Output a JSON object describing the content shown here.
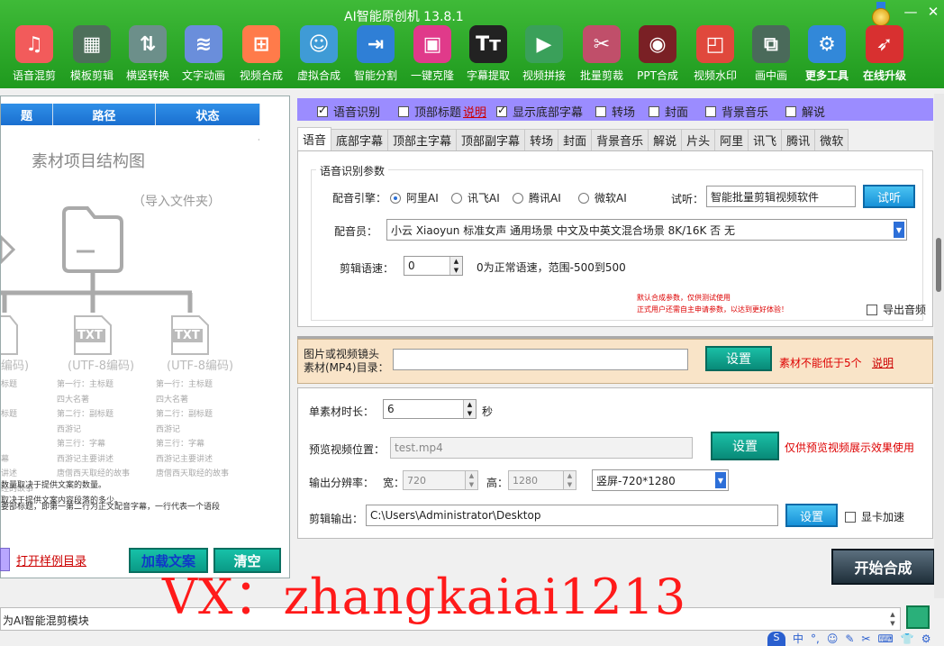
{
  "app": {
    "title": "AI智能原创机 13.8.1",
    "minimize": "—",
    "close": "✕"
  },
  "toolbar": [
    {
      "label": "语音混剪",
      "icon": "music-note-icon",
      "glyph": "♫",
      "color": "#f25b5b"
    },
    {
      "label": "模板剪辑",
      "icon": "template-icon",
      "glyph": "▦",
      "color": "#4d6f5a"
    },
    {
      "label": "横竖转换",
      "icon": "rotate-icon",
      "glyph": "⇅",
      "color": "#6c8f8a"
    },
    {
      "label": "文字动画",
      "icon": "waveform-icon",
      "glyph": "≋",
      "color": "#6a8edb"
    },
    {
      "label": "视频合成",
      "icon": "grid-icon",
      "glyph": "⊞",
      "color": "#ff7b4a"
    },
    {
      "label": "虚拟合成",
      "icon": "avatar-icon",
      "glyph": "☺",
      "color": "#3f9bd6"
    },
    {
      "label": "智能分割",
      "icon": "split-icon",
      "glyph": "⇥",
      "color": "#2f7fd6"
    },
    {
      "label": "一键克隆",
      "icon": "clone-icon",
      "glyph": "▣",
      "color": "#e03a8a"
    },
    {
      "label": "字幕提取",
      "icon": "text-tt-icon",
      "glyph": "Tт",
      "color": "#222222"
    },
    {
      "label": "视频拼接",
      "icon": "video-join-icon",
      "glyph": "▶",
      "color": "#3aa05a"
    },
    {
      "label": "批量剪裁",
      "icon": "crop-icon",
      "glyph": "✂",
      "color": "#c04f6a"
    },
    {
      "label": "PPT合成",
      "icon": "ppt-icon",
      "glyph": "◉",
      "color": "#7a2025"
    },
    {
      "label": "视频水印",
      "icon": "watermark-icon",
      "glyph": "◰",
      "color": "#e0483c"
    },
    {
      "label": "画中画",
      "icon": "pip-icon",
      "glyph": "⧉",
      "color": "#4a6a5a"
    },
    {
      "label": "更多工具",
      "icon": "more-tools-icon",
      "glyph": "⚙",
      "color": "#3288d9"
    },
    {
      "label": "在线升级",
      "icon": "rocket-icon",
      "glyph": "➶",
      "color": "#d83030"
    }
  ],
  "left": {
    "headers": [
      "题",
      "路径",
      "状态"
    ],
    "diagram_title": "素材项目结构图",
    "import_hint": "（导入文件夹）",
    "txt": "TXT",
    "enc_partial": "编码)",
    "enc": "(UTF-8编码)",
    "col1": "标题\n\n标题\n\n\n幕\n讲述\n经的故事",
    "col2": "第一行：主标题\n四大名著\n第二行：副标题\n西游记\n第三行：字幕\n西游记主要讲述\n唐僧西天取经的故事",
    "col3": "第一行：主标题\n四大名著\n第二行：副标题\n西游记\n第三行：字幕\n西游记主要讲述\n唐僧西天取经的故事",
    "note1": "要部标题，即第一第二行为正文配音字幕，一行代表一个语段",
    "note2": "数量取决于提供文案的数量。",
    "note3": "取决于提供文案内容段落的多少。",
    "open_dir": "打开样例目录",
    "load_btn": "加载文案",
    "clear_btn": "清空"
  },
  "checks": [
    {
      "label": "语音识别",
      "on": true
    },
    {
      "label": "顶部标题",
      "on": false
    },
    {
      "label": "说明",
      "link": true
    },
    {
      "label": "显示底部字幕",
      "on": true
    },
    {
      "label": "转场",
      "on": false
    },
    {
      "label": "封面",
      "on": false
    },
    {
      "label": "背景音乐",
      "on": false
    },
    {
      "label": "解说",
      "on": false
    }
  ],
  "tabs": [
    "语音",
    "底部字幕",
    "顶部主字幕",
    "顶部副字幕",
    "转场",
    "封面",
    "背景音乐",
    "解说",
    "片头",
    "阿里",
    "讯飞",
    "腾讯",
    "微软"
  ],
  "voice": {
    "group_title": "语音识别参数",
    "engine_label": "配音引擎：",
    "engines": [
      {
        "label": "阿里AI",
        "on": true
      },
      {
        "label": "讯飞AI",
        "on": false
      },
      {
        "label": "腾讯AI",
        "on": false
      },
      {
        "label": "微软AI",
        "on": false
      }
    ],
    "listen_label": "试听：",
    "listen_value": "智能批量剪辑视频软件",
    "listen_btn": "试听",
    "speaker_label": "配音员：",
    "speaker_value": "小云 Xiaoyun 标准女声 通用场景 中文及中英文混合场景 8K/16K 否 无",
    "speed_label": "剪辑语速：",
    "speed_value": "0",
    "speed_hint": "0为正常语速，范围-500到500",
    "warn1": "默认合成参数，仅供测试使用",
    "warn2": "正式用户还需自主申请参数，以达到更好体验！",
    "export_audio": "导出音频"
  },
  "material": {
    "label1": "图片或视频镜头",
    "label2": "素材(MP4)目录：",
    "value": "",
    "set_btn": "设置",
    "warn": "素材不能低于5个",
    "help": "说明"
  },
  "lower": {
    "duration_label": "单素材时长：",
    "duration_value": "6",
    "duration_unit": "秒",
    "preview_label": "预览视频位置：",
    "preview_value": "test.mp4",
    "preview_btn": "设置",
    "preview_hint": "仅供预览视频展示效果使用",
    "res_label": "输出分辨率：",
    "width_label": "宽：",
    "width_value": "720",
    "height_label": "高：",
    "height_value": "1280",
    "preset": "竖屏-720*1280",
    "output_label": "剪辑输出：",
    "output_value": "C:\\Users\\Administrator\\Desktop",
    "output_btn": "设置",
    "gpu_label": "显卡加速"
  },
  "start_btn": "开始合成",
  "status": "为AI智能混剪模块",
  "watermark": "VX：zhangkaiai1213",
  "ime": [
    "中",
    "°,",
    "☺",
    "✎",
    "✂",
    "⌨",
    "👕",
    "⚙"
  ]
}
